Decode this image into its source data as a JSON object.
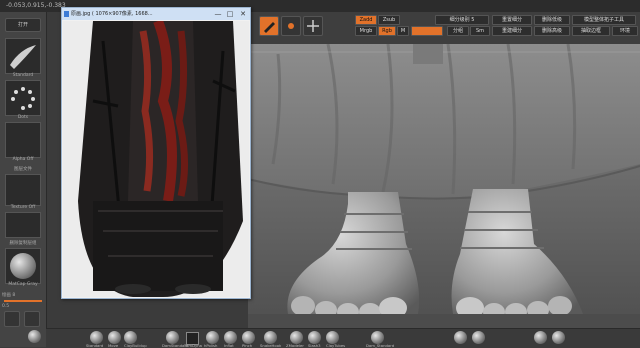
{
  "topbar": {
    "coords": "-0.053,0.915,-0.383"
  },
  "left_tray": {
    "brush_label": "Standard",
    "stroke_label": "Dots",
    "alpha_label": "Alpha Off",
    "texture_label": "Texture Off",
    "material_label": "MatCap Gray",
    "button_top": "打开",
    "panel_text_1": "图层文件",
    "panel_text_2": "删除复制层组",
    "draw_size": "绘画 8",
    "focal": "0.5"
  },
  "shelf": {
    "rgb_label": "Zadd",
    "zsub_label": "Zsub",
    "mrgb_label": "Mrgb",
    "rgb_btn": "Rgb",
    "m_btn": "M",
    "btn_1": "细分级别 5",
    "btn_2": "重置细分",
    "btn_3": "删除低级",
    "btn_4": "模型整体拓子工具",
    "btn_5": "重建细分",
    "btn_6": "删除高级",
    "btn_7": "抽取边框",
    "btn_8": "分组",
    "btn_9": "Sm",
    "btn_10": "环境"
  },
  "viewer": {
    "title": "原画.jpg ( 1076×907像素, 1668... ",
    "minimize": "—",
    "maximize": "□",
    "close": "✕"
  },
  "bottombar": {
    "labels": [
      "Standard",
      "Move",
      "ClayBuildup",
      "DamStandard",
      "TrimDyna",
      "hPolish",
      "Inflat",
      "Pinch",
      "SnakeHook",
      "ZModeler",
      "Slash3",
      "ClayTubes",
      "Dam_Standard"
    ]
  }
}
